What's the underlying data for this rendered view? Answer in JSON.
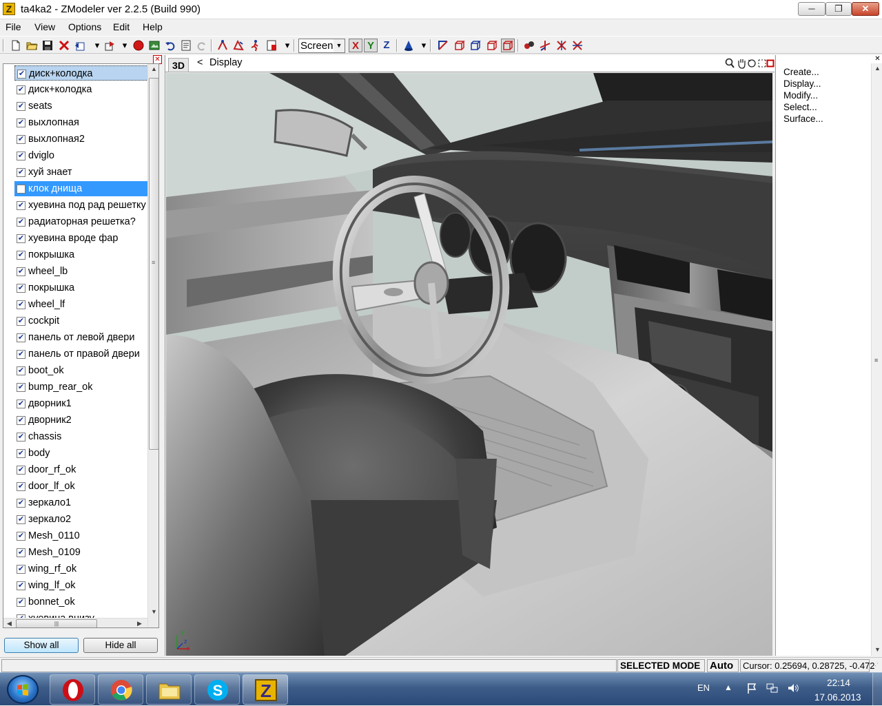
{
  "window": {
    "title": "ta4ka2 - ZModeler ver 2.2.5 (Build 990)",
    "app_icon_letter": "Z",
    "minimize_glyph": "─",
    "maximize_glyph": "❐",
    "close_glyph": "✕"
  },
  "menu": {
    "items": [
      "File",
      "View",
      "Options",
      "Edit",
      "Help"
    ]
  },
  "toolbar": {
    "view_select_value": "Screen",
    "axis_x": "X",
    "axis_y": "Y",
    "axis_z": "Z"
  },
  "objects": {
    "items": [
      {
        "label": "диск+колодка",
        "checked": true,
        "state": "focused"
      },
      {
        "label": "диск+колодка",
        "checked": true,
        "state": ""
      },
      {
        "label": "seats",
        "checked": true,
        "state": ""
      },
      {
        "label": "выхлопная",
        "checked": true,
        "state": ""
      },
      {
        "label": "выхлопная2",
        "checked": true,
        "state": ""
      },
      {
        "label": "dviglo",
        "checked": true,
        "state": ""
      },
      {
        "label": "хуй знает",
        "checked": true,
        "state": ""
      },
      {
        "label": "клок днища",
        "checked": false,
        "state": "selected"
      },
      {
        "label": "хуевина под рад решетку",
        "checked": true,
        "state": ""
      },
      {
        "label": "радиаторная решетка?",
        "checked": true,
        "state": ""
      },
      {
        "label": "хуевина вроде фар",
        "checked": true,
        "state": ""
      },
      {
        "label": "покрышка",
        "checked": true,
        "state": ""
      },
      {
        "label": "wheel_lb",
        "checked": true,
        "state": ""
      },
      {
        "label": "покрышка",
        "checked": true,
        "state": ""
      },
      {
        "label": "wheel_lf",
        "checked": true,
        "state": ""
      },
      {
        "label": "cockpit",
        "checked": true,
        "state": ""
      },
      {
        "label": "панель от левой двери",
        "checked": true,
        "state": ""
      },
      {
        "label": "панель от правой двери",
        "checked": true,
        "state": ""
      },
      {
        "label": "boot_ok",
        "checked": true,
        "state": ""
      },
      {
        "label": "bump_rear_ok",
        "checked": true,
        "state": ""
      },
      {
        "label": "дворник1",
        "checked": true,
        "state": ""
      },
      {
        "label": "дворник2",
        "checked": true,
        "state": ""
      },
      {
        "label": "chassis",
        "checked": true,
        "state": ""
      },
      {
        "label": "body",
        "checked": true,
        "state": ""
      },
      {
        "label": "door_rf_ok",
        "checked": true,
        "state": ""
      },
      {
        "label": "door_lf_ok",
        "checked": true,
        "state": ""
      },
      {
        "label": "зеркало1",
        "checked": true,
        "state": ""
      },
      {
        "label": "зеркало2",
        "checked": true,
        "state": ""
      },
      {
        "label": "Mesh_0110",
        "checked": true,
        "state": ""
      },
      {
        "label": "Mesh_0109",
        "checked": true,
        "state": ""
      },
      {
        "label": "wing_rf_ok",
        "checked": true,
        "state": ""
      },
      {
        "label": "wing_lf_ok",
        "checked": true,
        "state": ""
      },
      {
        "label": "bonnet_ok",
        "checked": true,
        "state": ""
      },
      {
        "label": "хуевина внизу",
        "checked": true,
        "state": ""
      }
    ],
    "show_all_label": "Show all",
    "hide_all_label": "Hide all"
  },
  "viewport": {
    "mode": "3D",
    "nav_arrow": "<",
    "name": "Display",
    "axis_y": "y",
    "axis_x": "x",
    "axis_z": "z"
  },
  "commands": {
    "items": [
      "Create...",
      "Display...",
      "Modify...",
      "Select...",
      "Surface..."
    ]
  },
  "status": {
    "mode": "SELECTED MODE",
    "snap": "Auto",
    "cursor": "Cursor: 0.25694, 0.28725, -0.472"
  },
  "taskbar": {
    "apps": [
      {
        "name": "opera",
        "color": "#cc0f16"
      },
      {
        "name": "chrome",
        "color": "#dd4b39"
      },
      {
        "name": "explorer",
        "color": "#e8c44a"
      },
      {
        "name": "skype",
        "color": "#00aff0"
      },
      {
        "name": "zmodeler",
        "color": "#e8b400"
      }
    ],
    "language": "EN",
    "time": "22:14",
    "date": "17.06.2013"
  },
  "colors": {
    "selection": "#3399ff",
    "scene_bg": "#c8c8c8",
    "title_close": "#c8452c"
  }
}
